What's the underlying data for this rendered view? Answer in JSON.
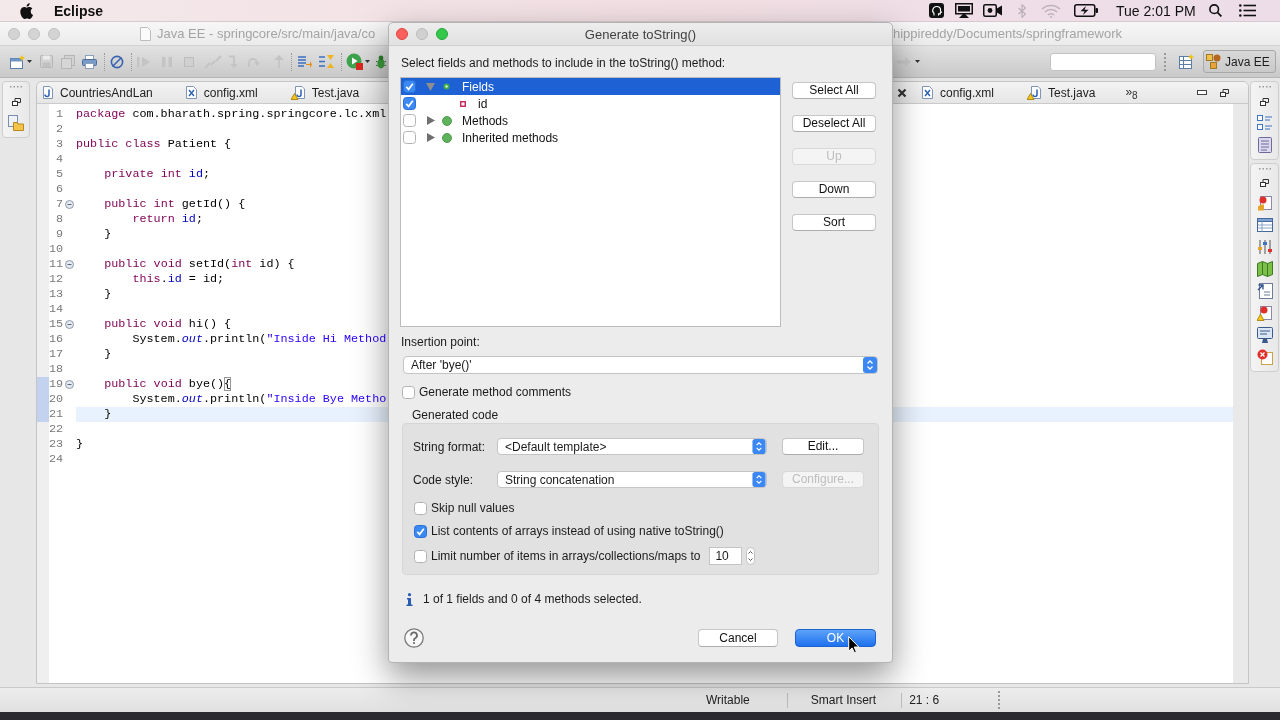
{
  "menu_bar": {
    "app_menu": "Eclipse",
    "clock": "Tue 2:01 PM"
  },
  "window": {
    "title_start": "Java EE - springcore/src/main/java/co",
    "title_end": "hippireddy/Documents/springframework"
  },
  "toolbar": {
    "perspectives": [
      {
        "label": "Java EE",
        "selected": true
      }
    ]
  },
  "editor": {
    "tabs": [
      {
        "label": "CountriesAndLan",
        "kind": "java",
        "selected": false
      },
      {
        "label": "config.xml",
        "kind": "xml",
        "selected": false
      },
      {
        "label": "Test.java",
        "kind": "java_warning",
        "selected": false
      }
    ],
    "tabs_right": [
      {
        "label": "config.xml",
        "kind": "xml",
        "selected": false
      },
      {
        "label": "Test.java",
        "kind": "java_warning",
        "selected": false
      }
    ],
    "more_tabs": "»$_{8}$",
    "lines": [
      {
        "number": "1",
        "tokens": [
          {
            "kind": "keyword",
            "text": "package"
          },
          {
            "kind": "plain",
            "text": " com.bharath.spring.springcore.lc.xml"
          }
        ],
        "foldable": false,
        "in_range": false,
        "current": false
      },
      {
        "number": "2",
        "foldable": false,
        "in_range": false,
        "current": false
      },
      {
        "number": "3",
        "tokens": [
          {
            "kind": "keyword",
            "text": "public "
          },
          {
            "kind": "keyword",
            "text": "class"
          },
          {
            "kind": "plain",
            "text": " Patient {"
          }
        ],
        "foldable": false,
        "in_range": false,
        "current": false
      },
      {
        "number": "4",
        "foldable": false,
        "in_range": false,
        "current": false
      },
      {
        "number": "5",
        "tokens": [
          {
            "kind": "keyword",
            "text": "    private "
          },
          {
            "kind": "keyword",
            "text": "int "
          },
          {
            "kind": "field",
            "text": "id"
          },
          {
            "kind": "plain",
            "text": ";"
          }
        ],
        "foldable": false,
        "in_range": false,
        "current": false
      },
      {
        "number": "6",
        "foldable": false,
        "in_range": false,
        "current": false
      },
      {
        "number": "7",
        "tokens": [
          {
            "kind": "keyword",
            "text": "    public "
          },
          {
            "kind": "keyword",
            "text": "int"
          },
          {
            "kind": "plain",
            "text": " getId() {"
          }
        ],
        "foldable": true,
        "in_range": false,
        "current": false
      },
      {
        "number": "8",
        "tokens": [
          {
            "kind": "keyword",
            "text": "        return "
          },
          {
            "kind": "field",
            "text": "id"
          },
          {
            "kind": "plain",
            "text": ";"
          }
        ],
        "foldable": false,
        "in_range": false,
        "current": false
      },
      {
        "number": "9",
        "tokens": [
          {
            "kind": "plain",
            "text": "    }"
          }
        ],
        "foldable": false,
        "in_range": false,
        "current": false
      },
      {
        "number": "10",
        "foldable": false,
        "in_range": false,
        "current": false
      },
      {
        "number": "11",
        "tokens": [
          {
            "kind": "keyword",
            "text": "    public "
          },
          {
            "kind": "keyword",
            "text": "void"
          },
          {
            "kind": "plain",
            "text": " setId("
          },
          {
            "kind": "keyword",
            "text": "int"
          },
          {
            "kind": "plain",
            "text": " id) {"
          }
        ],
        "foldable": true,
        "in_range": false,
        "current": false
      },
      {
        "number": "12",
        "tokens": [
          {
            "kind": "keyword",
            "text": "        this"
          },
          {
            "kind": "plain",
            "text": "."
          },
          {
            "kind": "field",
            "text": "id"
          },
          {
            "kind": "plain",
            "text": " = id;"
          }
        ],
        "foldable": false,
        "in_range": false,
        "current": false
      },
      {
        "number": "13",
        "tokens": [
          {
            "kind": "plain",
            "text": "    }"
          }
        ],
        "foldable": false,
        "in_range": false,
        "current": false
      },
      {
        "number": "14",
        "foldable": false,
        "in_range": false,
        "current": false
      },
      {
        "number": "15",
        "tokens": [
          {
            "kind": "keyword",
            "text": "    public "
          },
          {
            "kind": "keyword",
            "text": "void"
          },
          {
            "kind": "plain",
            "text": " hi() {"
          }
        ],
        "foldable": true,
        "in_range": false,
        "current": false
      },
      {
        "number": "16",
        "tokens": [
          {
            "kind": "plain",
            "text": "        System."
          },
          {
            "kind": "static_field",
            "text": "out"
          },
          {
            "kind": "plain",
            "text": ".println("
          },
          {
            "kind": "string",
            "text": "\"Inside Hi Method"
          }
        ],
        "foldable": false,
        "in_range": false,
        "current": false
      },
      {
        "number": "17",
        "tokens": [
          {
            "kind": "plain",
            "text": "    }"
          }
        ],
        "foldable": false,
        "in_range": false,
        "current": false
      },
      {
        "number": "18",
        "foldable": false,
        "in_range": false,
        "current": false
      },
      {
        "number": "19",
        "tokens": [
          {
            "kind": "keyword",
            "text": "    public "
          },
          {
            "kind": "keyword",
            "text": "void"
          },
          {
            "kind": "plain",
            "text": " bye()"
          },
          {
            "kind": "bracket_match",
            "text": "{"
          }
        ],
        "foldable": true,
        "in_range": true,
        "current": false
      },
      {
        "number": "20",
        "tokens": [
          {
            "kind": "plain",
            "text": "        System."
          },
          {
            "kind": "static_field",
            "text": "out"
          },
          {
            "kind": "plain",
            "text": ".println("
          },
          {
            "kind": "string",
            "text": "\"Inside Bye Metho"
          }
        ],
        "foldable": false,
        "in_range": true,
        "current": false
      },
      {
        "number": "21",
        "tokens": [
          {
            "kind": "plain",
            "text": "    }"
          }
        ],
        "foldable": false,
        "in_range": true,
        "current": true
      },
      {
        "number": "22",
        "foldable": false,
        "in_range": false,
        "current": false
      },
      {
        "number": "23",
        "tokens": [
          {
            "kind": "plain",
            "text": "}"
          }
        ],
        "foldable": false,
        "in_range": false,
        "current": false
      },
      {
        "number": "24",
        "foldable": false,
        "in_range": false,
        "current": false
      }
    ]
  },
  "status_bar": {
    "edit_mode": "Writable",
    "insert_mode": "Smart Insert",
    "cursor_position": "21 : 6"
  },
  "dialog": {
    "title": "Generate toString()",
    "instruction": "Select fields and methods to include in the toString() method:",
    "members": [
      {
        "label": "Fields",
        "kind": "fields",
        "checked": true,
        "selected": true,
        "expanded": true,
        "children": [
          {
            "label": "id",
            "kind": "private_field",
            "checked": true,
            "selected": false
          }
        ]
      },
      {
        "label": "Methods",
        "kind": "methods",
        "checked": false,
        "selected": false,
        "expanded": false
      },
      {
        "label": "Inherited methods",
        "kind": "methods",
        "checked": false,
        "selected": false,
        "expanded": false
      }
    ],
    "list_buttons": [
      {
        "label": "Select All",
        "disabled": false
      },
      {
        "label": "Deselect All",
        "disabled": false
      },
      {
        "label": "Up",
        "disabled": true
      },
      {
        "label": "Down",
        "disabled": false
      },
      {
        "label": "Sort",
        "disabled": false
      }
    ],
    "insertion_point": {
      "label": "Insertion point:",
      "value": "After 'bye()'"
    },
    "method_comments": {
      "label": "Generate method comments",
      "checked": false
    },
    "generated_code": {
      "title": "Generated code",
      "string_format": {
        "label": "String format:",
        "value": "<Default template>",
        "button": {
          "label": "Edit...",
          "disabled": false
        }
      },
      "code_style": {
        "label": "Code style:",
        "value": "String concatenation",
        "button": {
          "label": "Configure...",
          "disabled": true
        }
      },
      "options": [
        {
          "kind": "checkbox",
          "label": "Skip null values",
          "checked": false
        },
        {
          "kind": "checkbox",
          "label": "List contents of arrays instead of using native toString()",
          "checked": true
        },
        {
          "kind": "checkbox_number",
          "label": "Limit number of items in arrays/collections/maps to",
          "checked": false,
          "value": "10"
        }
      ]
    },
    "status_message": "1 of 1 fields and 0 of 4 methods selected.",
    "buttons": [
      {
        "label": "Cancel",
        "default": false
      },
      {
        "label": "OK",
        "default": true
      }
    ]
  }
}
